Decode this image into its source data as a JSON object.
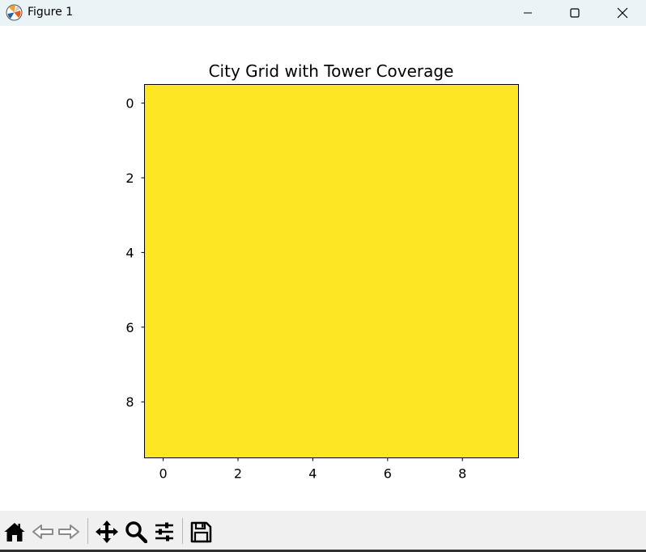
{
  "window": {
    "title": "Figure 1"
  },
  "colors": {
    "titlebar_bg": "#eaf3f6",
    "heatmap_fill": "#fde725",
    "toolbar_bg": "#f0f0f0"
  },
  "toolbar": {
    "icons": [
      "home-icon",
      "back-arrow-icon",
      "forward-arrow-icon",
      "pan-icon",
      "zoom-icon",
      "configure-subplots-icon",
      "save-icon"
    ]
  },
  "chart_data": {
    "type": "heatmap",
    "title": "City Grid with Tower Coverage",
    "xlabel": "",
    "ylabel": "",
    "x_ticks": [
      "0",
      "2",
      "4",
      "6",
      "8"
    ],
    "y_ticks": [
      "0",
      "2",
      "4",
      "6",
      "8"
    ],
    "xlim": [
      -0.5,
      9.5
    ],
    "ylim": [
      9.5,
      -0.5
    ],
    "rows": 10,
    "cols": 10,
    "values": [
      [
        1,
        1,
        1,
        1,
        1,
        1,
        1,
        1,
        1,
        1
      ],
      [
        1,
        1,
        1,
        1,
        1,
        1,
        1,
        1,
        1,
        1
      ],
      [
        1,
        1,
        1,
        1,
        1,
        1,
        1,
        1,
        1,
        1
      ],
      [
        1,
        1,
        1,
        1,
        1,
        1,
        1,
        1,
        1,
        1
      ],
      [
        1,
        1,
        1,
        1,
        1,
        1,
        1,
        1,
        1,
        1
      ],
      [
        1,
        1,
        1,
        1,
        1,
        1,
        1,
        1,
        1,
        1
      ],
      [
        1,
        1,
        1,
        1,
        1,
        1,
        1,
        1,
        1,
        1
      ],
      [
        1,
        1,
        1,
        1,
        1,
        1,
        1,
        1,
        1,
        1
      ],
      [
        1,
        1,
        1,
        1,
        1,
        1,
        1,
        1,
        1,
        1
      ],
      [
        1,
        1,
        1,
        1,
        1,
        1,
        1,
        1,
        1,
        1
      ]
    ],
    "colormap": "viridis",
    "grid": false
  }
}
